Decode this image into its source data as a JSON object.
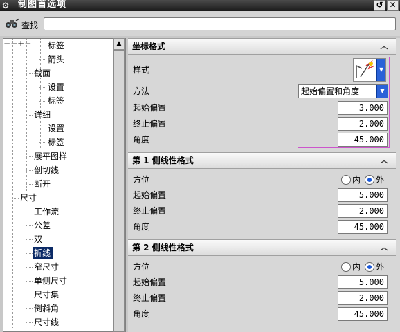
{
  "window": {
    "title": "制图首选项",
    "reset_glyph": "↺",
    "close_glyph": "✕"
  },
  "search": {
    "label": "查找",
    "value": ""
  },
  "tree": {
    "items": [
      {
        "label": "标签",
        "level": 3
      },
      {
        "label": "箭头",
        "level": 3
      },
      {
        "label": "截面",
        "level": 2,
        "expander": "−"
      },
      {
        "label": "设置",
        "level": 3
      },
      {
        "label": "标签",
        "level": 3
      },
      {
        "label": "详细",
        "level": 2,
        "expander": "−"
      },
      {
        "label": "设置",
        "level": 3
      },
      {
        "label": "标签",
        "level": 3
      },
      {
        "label": "展平图样",
        "level": 2,
        "expander": "+"
      },
      {
        "label": "剖切线",
        "level": 2
      },
      {
        "label": "断开",
        "level": 2
      },
      {
        "label": "尺寸",
        "level": 1,
        "expander": "−"
      },
      {
        "label": "工作流",
        "level": 2
      },
      {
        "label": "公差",
        "level": 2
      },
      {
        "label": "双",
        "level": 2
      },
      {
        "label": "折线",
        "level": 2,
        "selected": true
      },
      {
        "label": "窄尺寸",
        "level": 2
      },
      {
        "label": "单侧尺寸",
        "level": 2
      },
      {
        "label": "尺寸集",
        "level": 2
      },
      {
        "label": "倒斜角",
        "level": 2
      },
      {
        "label": "尺寸线",
        "level": 2
      }
    ]
  },
  "coord_format": {
    "heading": "坐标格式",
    "style_label": "样式",
    "method_label": "方法",
    "method_value": "起始偏置和角度",
    "start_offset_label": "起始偏置",
    "start_offset": "3.000",
    "end_offset_label": "终止偏置",
    "end_offset": "2.000",
    "angle_label": "角度",
    "angle": "45.000"
  },
  "side1": {
    "heading": "第 1 侧线性格式",
    "orientation_label": "方位",
    "inner_label": "内",
    "outer_label": "外",
    "selected": "outer",
    "start_offset_label": "起始偏置",
    "start_offset": "5.000",
    "end_offset_label": "终止偏置",
    "end_offset": "2.000",
    "angle_label": "角度",
    "angle": "45.000"
  },
  "side2": {
    "heading": "第 2 侧线性格式",
    "orientation_label": "方位",
    "inner_label": "内",
    "outer_label": "外",
    "selected": "outer",
    "start_offset_label": "起始偏置",
    "start_offset": "5.000",
    "end_offset_label": "终止偏置",
    "end_offset": "2.000",
    "angle_label": "角度",
    "angle": "45.000"
  },
  "icons": {
    "app": "gear-icon",
    "search": "binoculars-icon",
    "style": "jog-line-style-icon",
    "collapse": "chevron-up-icon",
    "dropdown": "chevron-down-icon"
  },
  "colors": {
    "selection": "#0b2a66",
    "dropdown_accent": "#2a62d8",
    "highlight_border": "#cc55cc"
  }
}
